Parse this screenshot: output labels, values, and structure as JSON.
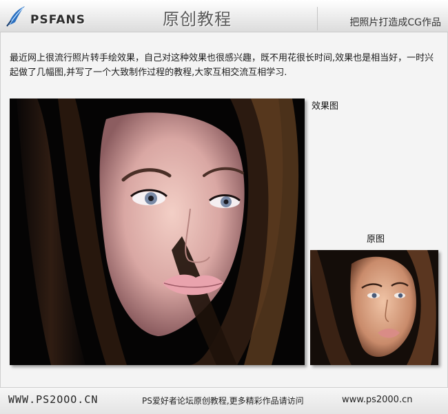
{
  "header": {
    "logo_text": "PSFANS",
    "title": "原创教程",
    "subtitle": "把照片打造成CG作品"
  },
  "intro": {
    "text": "最近网上很流行照片转手绘效果，自己对这种效果也很感兴趣，既不用花很长时间,效果也是相当好，一时兴起做了几幅图,并写了一个大致制作过程的教程,大家互相交流互相学习."
  },
  "figures": {
    "effect_label": "效果图",
    "original_label": "原图"
  },
  "footer": {
    "site": "WWW.PS2OOO.CN",
    "slogan": "PS爱好者论坛原创教程,更多精彩作品请访问",
    "url": "www.ps2000.cn"
  },
  "colors": {
    "header_bg": "#e6e6e6",
    "page_bg": "#f4f4f4",
    "logo_blue": "#2a6fc0"
  }
}
